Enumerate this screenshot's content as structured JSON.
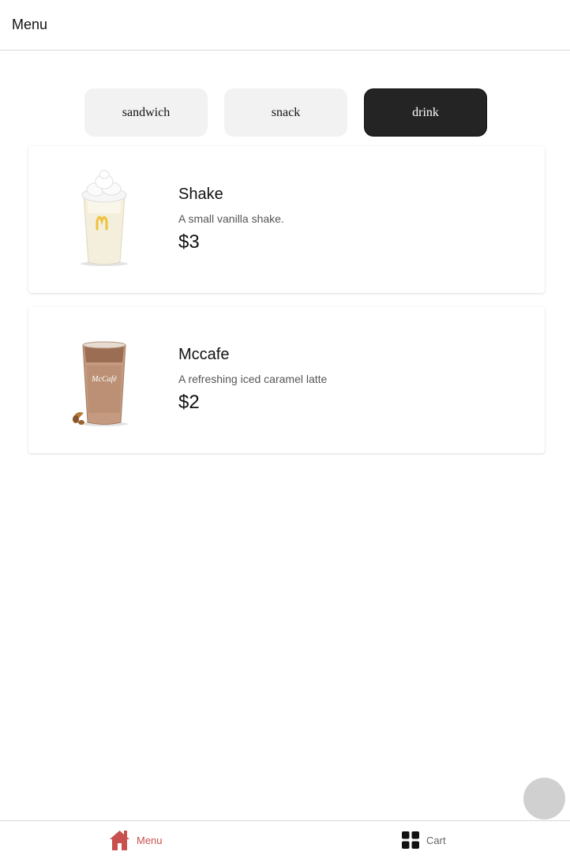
{
  "header": {
    "title": "Menu"
  },
  "categories": [
    {
      "label": "sandwich",
      "active": false
    },
    {
      "label": "snack",
      "active": false
    },
    {
      "label": "drink",
      "active": true
    }
  ],
  "items": [
    {
      "name": "Shake",
      "description": "A small vanilla shake.",
      "price": "$3",
      "image": "vanilla-shake-image"
    },
    {
      "name": "Mccafe",
      "description": "A refreshing iced caramel latte",
      "price": "$2",
      "image": "iced-caramel-latte-image",
      "cup_label": "McCafé"
    }
  ],
  "bottom_nav": {
    "menu": {
      "label": "Menu",
      "icon": "home-icon",
      "active": true
    },
    "cart": {
      "label": "Cart",
      "icon": "grid-icon",
      "active": false
    }
  },
  "colors": {
    "active_nav": "#c8504f",
    "active_tab": "#242424",
    "tab_bg": "#f2f2f2",
    "fab": "#d0d0d0"
  }
}
